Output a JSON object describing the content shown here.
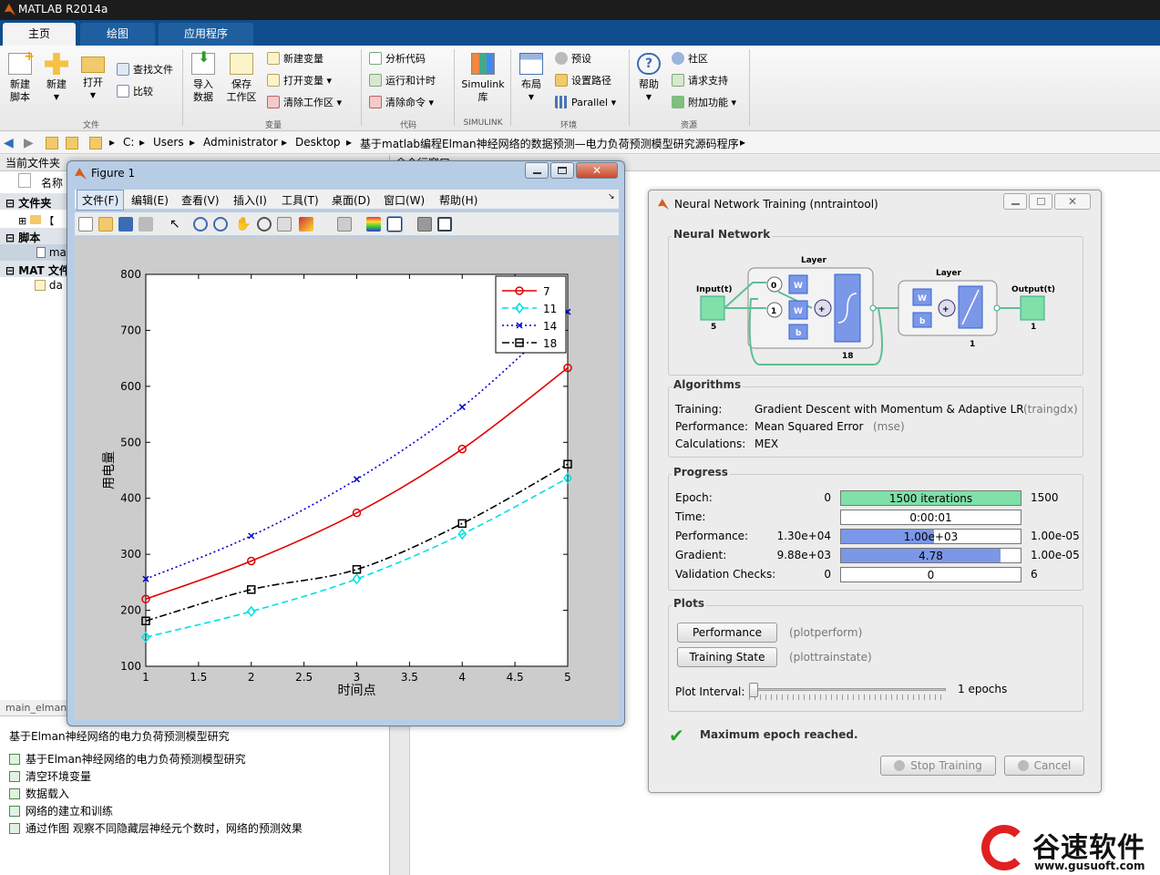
{
  "app": {
    "title": "MATLAB R2014a"
  },
  "tabs": [
    {
      "label": "主页"
    },
    {
      "label": "绘图"
    },
    {
      "label": "应用程序"
    }
  ],
  "ribbon": {
    "new_script": "新建\n脚本",
    "new": "新建",
    "open": "打开",
    "find_files": "查找文件",
    "compare": "比较",
    "group_file": "文件",
    "import_data": "导入\n数据",
    "save_workspace": "保存\n工作区",
    "new_variable": "新建变量",
    "open_variable": "打开变量",
    "clear_workspace": "清除工作区",
    "group_variable": "变量",
    "analyze_code": "分析代码",
    "run_and_time": "运行和计时",
    "clear_commands": "清除命令",
    "group_code": "代码",
    "simulink": "Simulink\n库",
    "group_simulink": "SIMULINK",
    "layout": "布局",
    "preferences": "预设",
    "set_path": "设置路径",
    "parallel": "Parallel",
    "group_env": "环境",
    "help": "帮助",
    "community": "社区",
    "request_support": "请求支持",
    "addons": "附加功能",
    "group_resources": "资源"
  },
  "address": {
    "segments": [
      "C:",
      "Users",
      "Administrator",
      "Desktop",
      "基于matlab编程Elman神经网络的数据预测—电力负荷预测模型研究源码程序"
    ]
  },
  "left_panel": {
    "header": "当前文件夹",
    "col_name": "名称",
    "tree": [
      "文件夹",
      "脚本",
      "MAT 文件"
    ],
    "file_items": [
      "ma",
      "da"
    ],
    "detail_header": "main_elman.",
    "detail_title": "基于Elman神经网络的电力负荷预测模型研究",
    "cells": [
      "基于Elman神经网络的电力负荷预测模型研究",
      "清空环境变量",
      "数据载入",
      "网络的建立和训练",
      "通过作图 观察不同隐藏层神经元个数时，网络的预测效果"
    ]
  },
  "right_panel": {
    "header": "命令行窗口"
  },
  "figure": {
    "title": "Figure 1",
    "menu": [
      "文件(F)",
      "编辑(E)",
      "查看(V)",
      "插入(I)",
      "工具(T)",
      "桌面(D)",
      "窗口(W)",
      "帮助(H)"
    ]
  },
  "chart_data": {
    "type": "line",
    "x": [
      1,
      2,
      3,
      4,
      5
    ],
    "xlabel": "时间点",
    "ylabel": "用电量",
    "xlim": [
      1,
      5
    ],
    "ylim": [
      100,
      800
    ],
    "xticks": [
      "1",
      "1.5",
      "2",
      "2.5",
      "3",
      "3.5",
      "4",
      "4.5",
      "5"
    ],
    "yticks": [
      "100",
      "200",
      "300",
      "400",
      "500",
      "600",
      "700",
      "800"
    ],
    "legend_position": "top-right",
    "series": [
      {
        "name": "7",
        "values": [
          220,
          288,
          374,
          488,
          633
        ],
        "color": "#e00000",
        "marker": "circle",
        "style": "solid"
      },
      {
        "name": "11",
        "values": [
          152,
          198,
          256,
          336,
          436
        ],
        "color": "#00e0e0",
        "marker": "diamond",
        "style": "dashed"
      },
      {
        "name": "14",
        "values": [
          256,
          333,
          434,
          563,
          733
        ],
        "color": "#0000d0",
        "marker": "x",
        "style": "dotted"
      },
      {
        "name": "18",
        "values": [
          181,
          237,
          273,
          355,
          461
        ],
        "color": "#000000",
        "marker": "square",
        "style": "dashdot"
      }
    ]
  },
  "nntool": {
    "title": "Neural Network Training (nntraintool)",
    "nn_section": "Neural Network",
    "diagram": {
      "input": "Input(t)",
      "input_n": "5",
      "layer1": "Layer",
      "layer1_n": "18",
      "layer2": "Layer",
      "layer2_n": "1",
      "output": "Output(t)",
      "output_n": "1",
      "w": "W",
      "b": "b",
      "d0": "0",
      "d1": "1",
      "plus": "+"
    },
    "algorithms_section": "Algorithms",
    "algorithms": [
      {
        "label": "Training:",
        "value": "Gradient Descent with Momentum & Adaptive LR",
        "note": "(traingdx)"
      },
      {
        "label": "Performance:",
        "value": "Mean Squared Error",
        "note": "(mse)"
      },
      {
        "label": "Calculations:",
        "value": "MEX",
        "note": ""
      }
    ],
    "progress_section": "Progress",
    "progress": [
      {
        "label": "Epoch:",
        "start": "0",
        "text": "1500 iterations",
        "end": "1500",
        "fill": 1.0,
        "color": "#7fe0a8"
      },
      {
        "label": "Time:",
        "start": "",
        "text": "0:00:01",
        "end": "",
        "fill": 0,
        "color": "#7b97e8"
      },
      {
        "label": "Performance:",
        "start": "1.30e+04",
        "text": "1.00e+03",
        "end": "1.00e-05",
        "fill": 0.52,
        "color": "#7b97e8"
      },
      {
        "label": "Gradient:",
        "start": "9.88e+03",
        "text": "4.78",
        "end": "1.00e-05",
        "fill": 0.89,
        "color": "#7b97e8"
      },
      {
        "label": "Validation Checks:",
        "start": "0",
        "text": "0",
        "end": "6",
        "fill": 0,
        "color": "#7b97e8"
      }
    ],
    "plots_section": "Plots",
    "plots": [
      {
        "button": "Performance",
        "fn": "(plotperform)"
      },
      {
        "button": "Training State",
        "fn": "(plottrainstate)"
      }
    ],
    "plot_interval_label": "Plot Interval:",
    "plot_interval_value": "1 epochs",
    "status": "Maximum epoch reached.",
    "stop_button": "Stop Training",
    "cancel_button": "Cancel"
  },
  "watermark": {
    "brand": "谷速软件",
    "url": "www.gusuoft.com"
  }
}
